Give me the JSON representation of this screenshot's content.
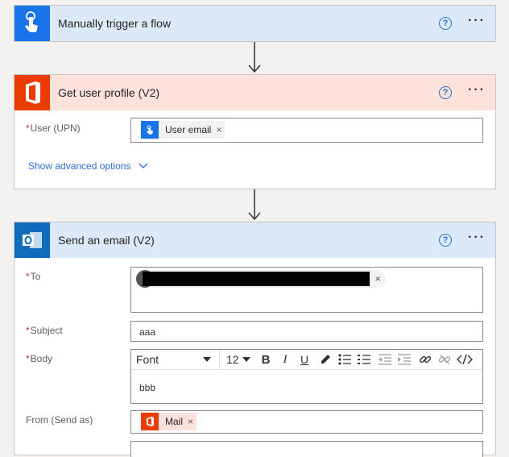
{
  "trigger": {
    "title": "Manually trigger a flow",
    "help": "?",
    "more": "···"
  },
  "profile": {
    "title": "Get user profile (V2)",
    "help": "?",
    "more": "···",
    "user_label": "User (UPN)",
    "required_mark": "*",
    "user_token": "User email",
    "remove": "×",
    "advanced": "Show advanced options"
  },
  "email": {
    "title": "Send an email (V2)",
    "help": "?",
    "more": "···",
    "required_mark": "*",
    "to_label": "To",
    "to_remove": "×",
    "subject_label": "Subject",
    "subject_value": "aaa",
    "body_label": "Body",
    "font": "Font",
    "font_size": "12",
    "bold": "B",
    "italic": "I",
    "underline": "U",
    "body_value": "bbb",
    "from_label": "From (Send as)",
    "from_token": "Mail",
    "from_remove": "×"
  },
  "colors": {
    "trigger_header": "#dce9f9",
    "trigger_icon": "#1a73e8",
    "office_header": "#fde2db",
    "office_icon": "#eb3c00",
    "outlook_header": "#dce9f9",
    "outlook_icon": "#0f6cbd",
    "link": "#2c6fd1",
    "required": "#d13438"
  }
}
